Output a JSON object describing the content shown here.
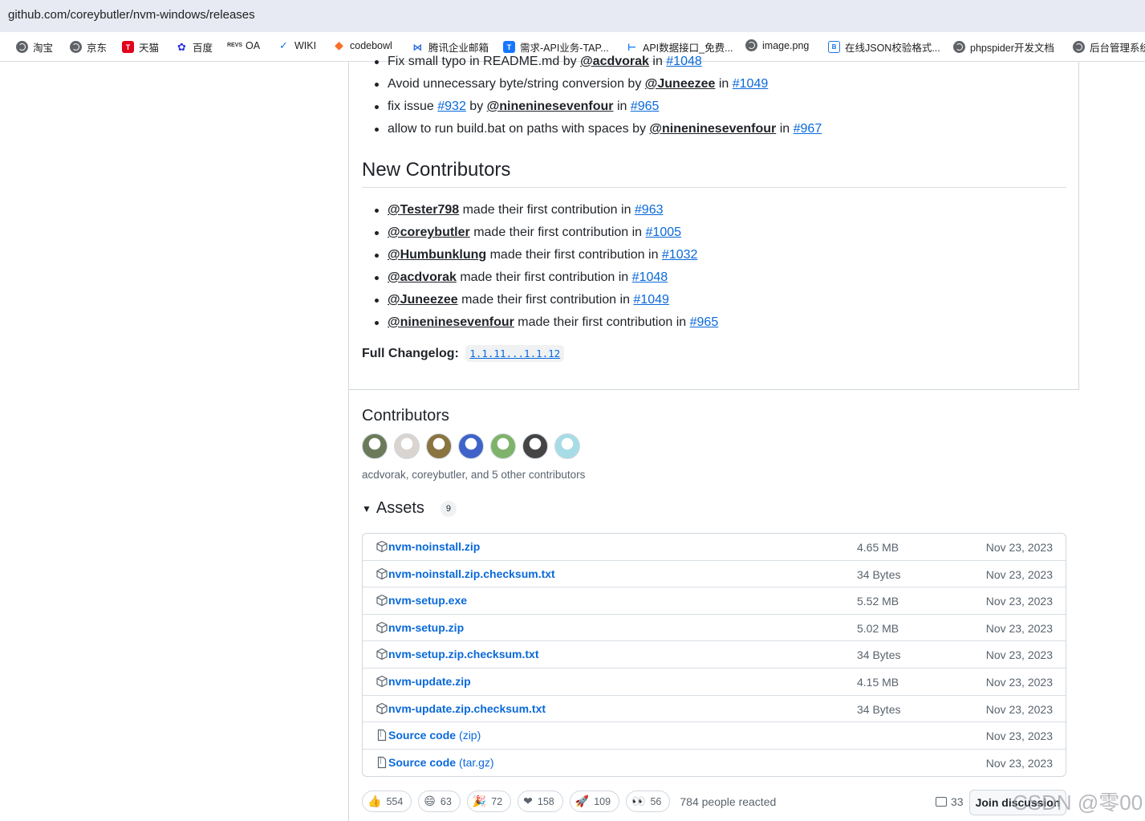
{
  "browser": {
    "url": "github.com/coreybutler/nvm-windows/releases",
    "bookmarks": [
      {
        "label": "淘宝",
        "icon": "globe-icon"
      },
      {
        "label": "京东",
        "icon": "globe-icon"
      },
      {
        "label": "天猫",
        "icon": "tmall-icon"
      },
      {
        "label": "百度",
        "icon": "baidu-icon"
      },
      {
        "label": "OA",
        "icon": "oa-icon"
      },
      {
        "label": "WIKI",
        "icon": "wiki-icon"
      },
      {
        "label": "codebowl",
        "icon": "gitlab-icon"
      },
      {
        "label": "腾讯企业邮箱",
        "icon": "mail-icon"
      },
      {
        "label": "需求-API业务-TAP...",
        "icon": "tap-icon"
      },
      {
        "label": "API数据接口_免费...",
        "icon": "api-icon"
      },
      {
        "label": "image.png",
        "icon": "globe-icon"
      },
      {
        "label": "在线JSON校验格式...",
        "icon": "json-icon"
      },
      {
        "label": "phpspider开发文档",
        "icon": "globe-icon"
      },
      {
        "label": "后台管理系统",
        "icon": "globe-icon"
      }
    ]
  },
  "changes": {
    "items": [
      {
        "text": "Fix small typo in README.md by ",
        "user": "@acdvorak",
        "mid": " in ",
        "pr": "#1048"
      },
      {
        "text": "Avoid unnecessary byte/string conversion by ",
        "user": "@Juneezee",
        "mid": " in ",
        "pr": "#1049"
      },
      {
        "text": "fix issue ",
        "pr_inline": "#932",
        "text2": " by ",
        "user": "@nineninesevenfour",
        "mid": " in ",
        "pr": "#965"
      },
      {
        "text": "allow to run build.bat on paths with spaces by ",
        "user": "@nineninesevenfour",
        "mid": " in ",
        "pr": "#967"
      }
    ]
  },
  "new_contributors": {
    "title": "New Contributors",
    "suffix": " made their first contribution in ",
    "items": [
      {
        "user": "@Tester798",
        "pr": "#963"
      },
      {
        "user": "@coreybutler",
        "pr": "#1005"
      },
      {
        "user": "@Humbunklung",
        "pr": "#1032"
      },
      {
        "user": "@acdvorak",
        "pr": "#1048"
      },
      {
        "user": "@Juneezee",
        "pr": "#1049"
      },
      {
        "user": "@nineninesevenfour",
        "pr": "#965"
      }
    ]
  },
  "changelog": {
    "label": "Full Changelog:",
    "link": "1.1.11...1.1.12"
  },
  "contributors": {
    "title": "Contributors",
    "summary": "acdvorak, coreybutler, and 5 other contributors",
    "avatar_colors": [
      "#6b7b5a",
      "#d9d4cf",
      "#8a7440",
      "#3f63c9",
      "#7fb36b",
      "#444444",
      "#a6dce6"
    ]
  },
  "assets": {
    "title": "Assets",
    "count": "9",
    "rows": [
      {
        "name": "nvm-noinstall.zip",
        "suffix": "",
        "size": "4.65 MB",
        "date": "Nov 23, 2023",
        "icon": "package-icon"
      },
      {
        "name": "nvm-noinstall.zip.checksum.txt",
        "suffix": "",
        "size": "34 Bytes",
        "date": "Nov 23, 2023",
        "icon": "package-icon"
      },
      {
        "name": "nvm-setup.exe",
        "suffix": "",
        "size": "5.52 MB",
        "date": "Nov 23, 2023",
        "icon": "package-icon"
      },
      {
        "name": "nvm-setup.zip",
        "suffix": "",
        "size": "5.02 MB",
        "date": "Nov 23, 2023",
        "icon": "package-icon"
      },
      {
        "name": "nvm-setup.zip.checksum.txt",
        "suffix": "",
        "size": "34 Bytes",
        "date": "Nov 23, 2023",
        "icon": "package-icon"
      },
      {
        "name": "nvm-update.zip",
        "suffix": "",
        "size": "4.15 MB",
        "date": "Nov 23, 2023",
        "icon": "package-icon"
      },
      {
        "name": "nvm-update.zip.checksum.txt",
        "suffix": "",
        "size": "34 Bytes",
        "date": "Nov 23, 2023",
        "icon": "package-icon"
      },
      {
        "name": "Source code",
        "suffix": "(zip)",
        "size": "",
        "date": "Nov 23, 2023",
        "icon": "file-zip-icon"
      },
      {
        "name": "Source code",
        "suffix": "(tar.gz)",
        "size": "",
        "date": "Nov 23, 2023",
        "icon": "file-zip-icon"
      }
    ]
  },
  "reactions": {
    "items": [
      {
        "emoji": "👍",
        "count": "554",
        "name": "thumbs-up"
      },
      {
        "emoji": "😄",
        "count": "63",
        "name": "laugh"
      },
      {
        "emoji": "🎉",
        "count": "72",
        "name": "hooray"
      },
      {
        "emoji": "❤",
        "count": "158",
        "name": "heart"
      },
      {
        "emoji": "🚀",
        "count": "109",
        "name": "rocket"
      },
      {
        "emoji": "👀",
        "count": "56",
        "name": "eyes"
      }
    ],
    "people": "784 people reacted"
  },
  "discussion": {
    "comments": "33",
    "button": "Join discussion"
  },
  "watermark": "CSDN @零00",
  "colors": {
    "link": "#0969da",
    "text": "#1f2328",
    "muted": "#59636e",
    "border": "#d0d7de"
  }
}
